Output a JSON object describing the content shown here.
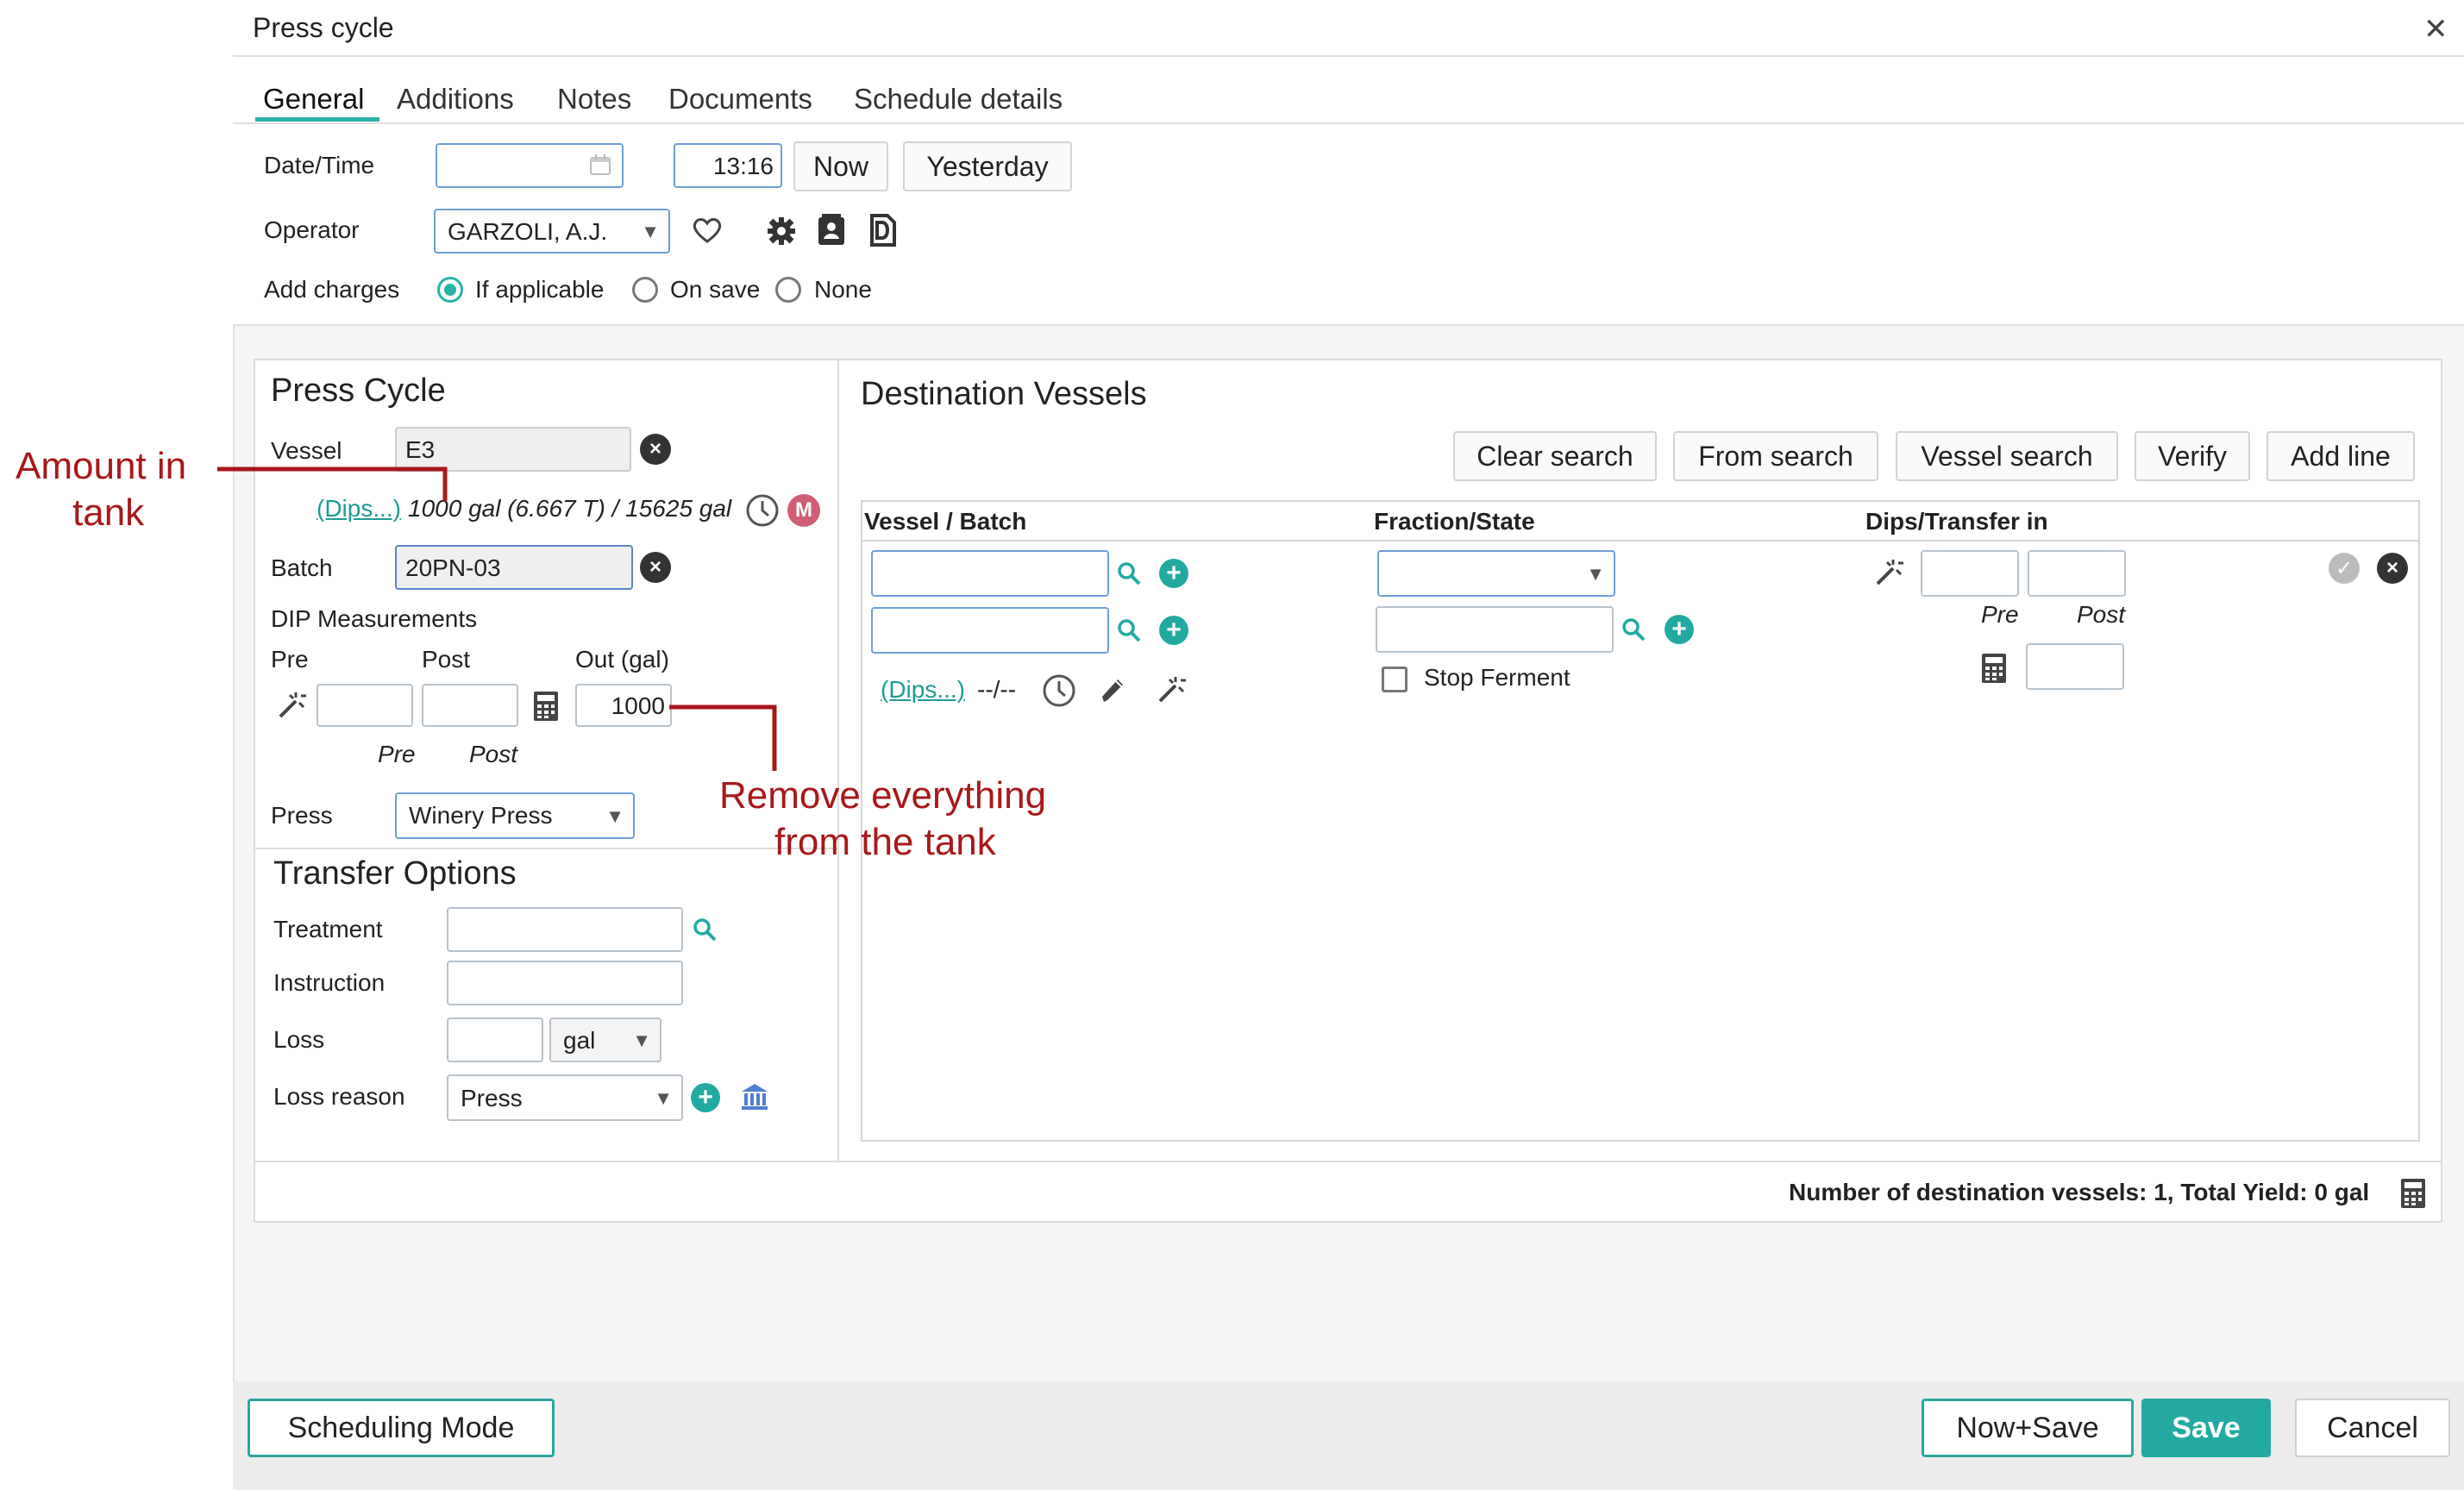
{
  "window": {
    "title": "Press cycle",
    "close_glyph": "✕"
  },
  "tabs": [
    {
      "label": "General",
      "active": true
    },
    {
      "label": "Additions"
    },
    {
      "label": "Notes"
    },
    {
      "label": "Documents"
    },
    {
      "label": "Schedule details"
    }
  ],
  "general": {
    "datetime_label": "Date/Time",
    "date_value": "",
    "time_value": "13:16",
    "now_button": "Now",
    "yesterday_button": "Yesterday",
    "operator_label": "Operator",
    "operator_value": "GARZOLI, A.J.",
    "add_charges_label": "Add charges",
    "charges_options": [
      "If applicable",
      "On save",
      "None"
    ],
    "charges_selected": "If applicable"
  },
  "press_cycle": {
    "title": "Press Cycle",
    "vessel_label": "Vessel",
    "vessel_value": "E3",
    "dips_link": "(Dips...)",
    "tank_info": "1000 gal (6.667 T) / 15625 gal",
    "m_badge": "M",
    "batch_label": "Batch",
    "batch_value": "20PN-03",
    "dip_title": "DIP Measurements",
    "pre_label": "Pre",
    "post_label": "Post",
    "out_label": "Out (gal)",
    "out_value": "1000",
    "pre_sub": "Pre",
    "post_sub": "Post",
    "press_label": "Press",
    "press_value": "Winery Press"
  },
  "transfer": {
    "title": "Transfer Options",
    "treatment_label": "Treatment",
    "instruction_label": "Instruction",
    "loss_label": "Loss",
    "loss_unit": "gal",
    "loss_reason_label": "Loss reason",
    "loss_reason_value": "Press"
  },
  "destination": {
    "title": "Destination Vessels",
    "buttons": [
      "Clear search",
      "From search",
      "Vessel search",
      "Verify",
      "Add line"
    ],
    "columns": [
      "Vessel / Batch",
      "Fraction/State",
      "Dips/Transfer in"
    ],
    "dips_link": "(Dips...)",
    "dips_value": "--/--",
    "stop_ferment": "Stop Ferment",
    "pre_sub": "Pre",
    "post_sub": "Post"
  },
  "summary": "Number of destination vessels: 1, Total Yield: 0 gal",
  "footer": {
    "scheduling_mode": "Scheduling Mode",
    "now_save": "Now+Save",
    "save": "Save",
    "cancel": "Cancel"
  },
  "annotations": {
    "amount_line1": "Amount in",
    "amount_line2": "tank",
    "remove_line1": "Remove everything",
    "remove_line2": "from the tank"
  },
  "colors": {
    "accent": "#22aaa2",
    "annotation": "#a8181b",
    "link": "#1f9c95"
  }
}
